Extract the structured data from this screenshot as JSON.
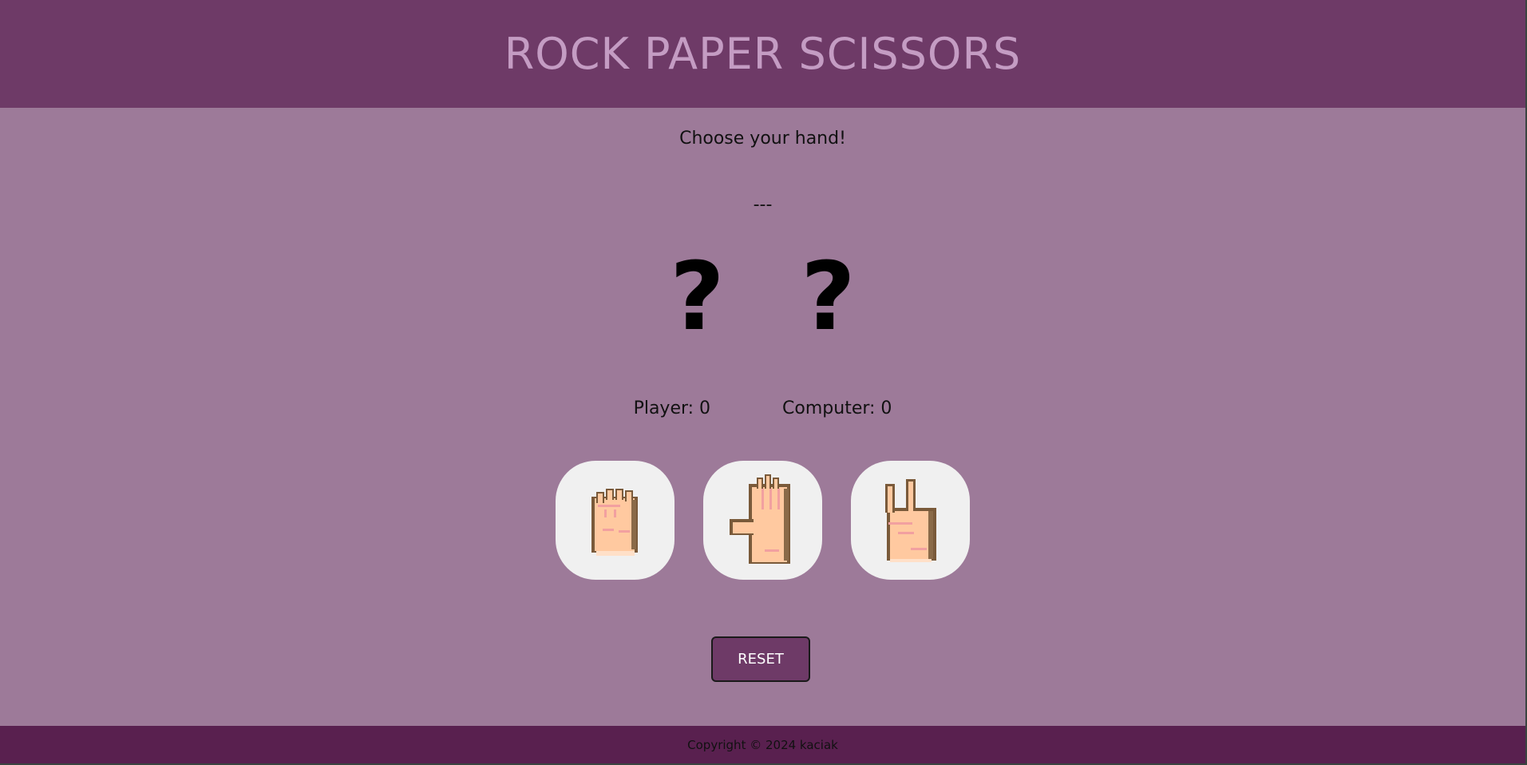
{
  "header": {
    "title": "ROCK PAPER SCISSORS"
  },
  "game": {
    "prompt": "Choose your hand!",
    "result": "---",
    "player_pick": "?",
    "computer_pick": "?"
  },
  "scores": {
    "player": "Player: 0",
    "computer": "Computer: 0"
  },
  "choices": [
    {
      "name": "rock",
      "icon": "fist-icon"
    },
    {
      "name": "paper",
      "icon": "open-hand-icon"
    },
    {
      "name": "scissors",
      "icon": "peace-hand-icon"
    }
  ],
  "controls": {
    "reset_label": "RESET"
  },
  "footer": {
    "copyright": "Copyright © 2024 kaciak"
  },
  "colors": {
    "header_bg": "#6e3a67",
    "page_bg": "#9d7a99",
    "footer_bg": "#59204f",
    "title_color": "#c49cc3",
    "button_bg": "#6e3a67",
    "hand_card_bg": "#f0f0f0"
  }
}
